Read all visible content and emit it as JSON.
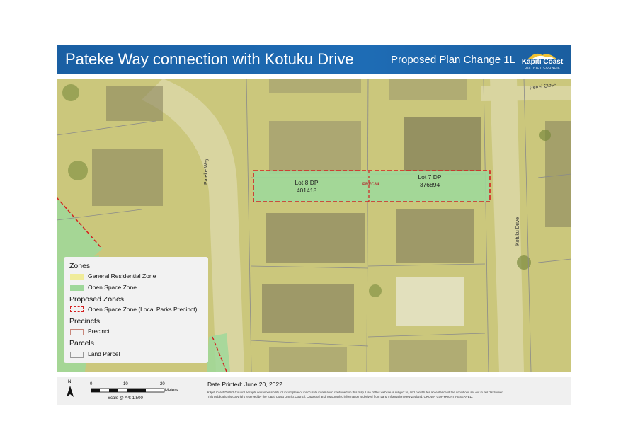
{
  "header": {
    "title": "Pateke Way connection with Kotuku Drive",
    "subtitle": "Proposed Plan Change 1L",
    "logo_text": "Kāpiti Coast",
    "logo_subtext": "DISTRICT COUNCIL"
  },
  "map": {
    "lots": [
      {
        "line1": "Lot 8 DP",
        "line2": "401418"
      },
      {
        "line1": "Lot 7 DP",
        "line2": "376894"
      }
    ],
    "precinct_code": "PREC34",
    "roads": {
      "pateke": "Pateke Way",
      "kotuku": "Kotuku Drive",
      "petrel": "Petrel Close"
    },
    "colors": {
      "residential_zone": "#d8d48a",
      "open_space_zone": "#9fd89a",
      "proposed_outline": "#d42020",
      "precinct_outline": "#c8867a",
      "parcel_line": "#888888"
    }
  },
  "legend": {
    "zones_heading": "Zones",
    "general_residential": "General Residential Zone",
    "open_space": "Open Space Zone",
    "proposed_heading": "Proposed Zones",
    "proposed_open_space": "Open Space Zone (Local Parks Precinct)",
    "precincts_heading": "Precincts",
    "precinct": "Precinct",
    "parcels_heading": "Parcels",
    "land_parcel": "Land Parcel"
  },
  "footer": {
    "date_printed": "Date Printed: June 20, 2022",
    "disclaimer_1": "Kāpiti Coast District Council accepts no responsibility for incomplete or inaccurate information contained on this map. Use of this website is subject to, and constitutes acceptance of the conditions set out in our disclaimer.",
    "disclaimer_2": "This publication is copyright reserved by the Kāpiti Coast District Council. Cadastral and Topographic information is derived from Land Information New Zealand. CROWN COPYRIGHT RESERVED.",
    "north_label": "N",
    "scale_ticks": [
      "0",
      "10",
      "20"
    ],
    "scale_unit": "Meters",
    "scale_note": "Scale @ A4: 1:500"
  }
}
